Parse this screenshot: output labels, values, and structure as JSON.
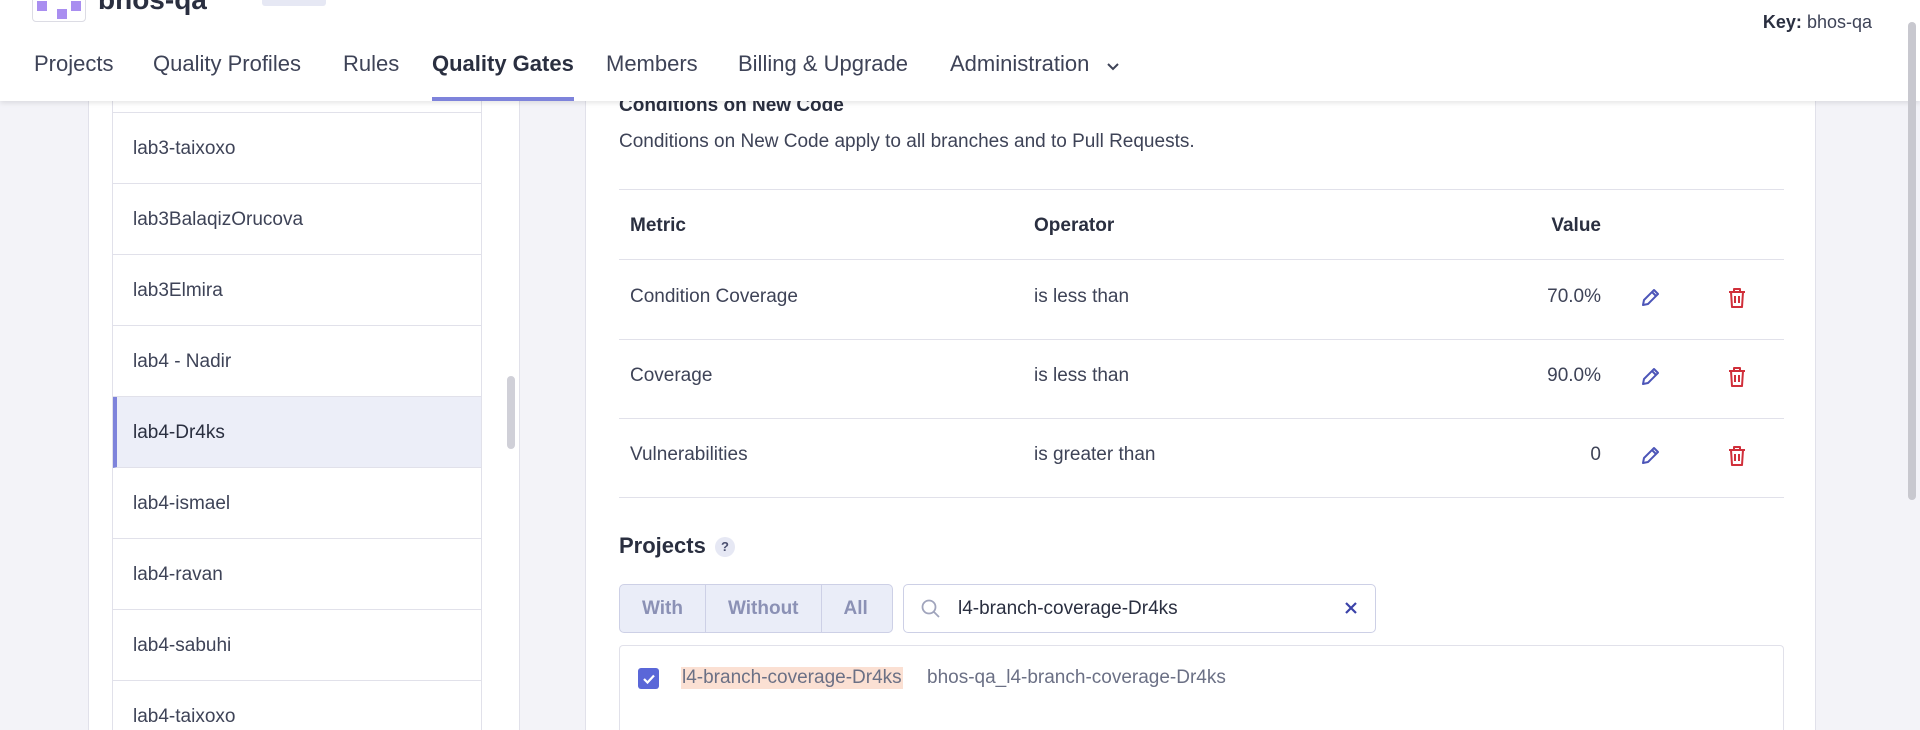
{
  "header": {
    "org_name": "bhos-qa",
    "key_label": "Key:",
    "key_value": "bhos-qa"
  },
  "nav": {
    "items": [
      {
        "label": "Projects"
      },
      {
        "label": "Quality Profiles"
      },
      {
        "label": "Rules"
      },
      {
        "label": "Quality Gates"
      },
      {
        "label": "Members"
      },
      {
        "label": "Billing & Upgrade"
      },
      {
        "label": "Administration"
      }
    ],
    "active": "Quality Gates"
  },
  "gates": {
    "items": [
      {
        "label": "lab3-taixoxo"
      },
      {
        "label": "lab3BalaqizOrucova"
      },
      {
        "label": "lab3Elmira"
      },
      {
        "label": "lab4 - Nadir"
      },
      {
        "label": "lab4-Dr4ks"
      },
      {
        "label": "lab4-ismael"
      },
      {
        "label": "lab4-ravan"
      },
      {
        "label": "lab4-sabuhi"
      },
      {
        "label": "lab4-taixoxo"
      }
    ],
    "selected": "lab4-Dr4ks"
  },
  "conditions": {
    "title": "Conditions on New Code",
    "description": "Conditions on New Code apply to all branches and to Pull Requests.",
    "headers": {
      "metric": "Metric",
      "operator": "Operator",
      "value": "Value"
    },
    "rows": [
      {
        "metric": "Condition Coverage",
        "operator": "is less than",
        "value": "70.0%"
      },
      {
        "metric": "Coverage",
        "operator": "is less than",
        "value": "90.0%"
      },
      {
        "metric": "Vulnerabilities",
        "operator": "is greater than",
        "value": "0"
      }
    ]
  },
  "projects": {
    "title": "Projects",
    "help": "?",
    "filters": [
      {
        "label": "With"
      },
      {
        "label": "Without"
      },
      {
        "label": "All"
      }
    ],
    "search_value": "l4-branch-coverage-Dr4ks",
    "results": [
      {
        "name": "l4-branch-coverage-Dr4ks",
        "key": "bhos-qa_l4-branch-coverage-Dr4ks",
        "checked": true
      }
    ]
  },
  "colors": {
    "accent": "#7e83db",
    "checkbox": "#5a67d8",
    "edit_icon": "#4c55b8",
    "delete_icon": "#d02f3a",
    "highlight": "#fbe0d3"
  },
  "icons": {
    "edit": "pencil-icon",
    "delete": "trash-icon",
    "search": "search-icon",
    "clear": "close-icon",
    "dropdown": "chevron-down-icon"
  }
}
